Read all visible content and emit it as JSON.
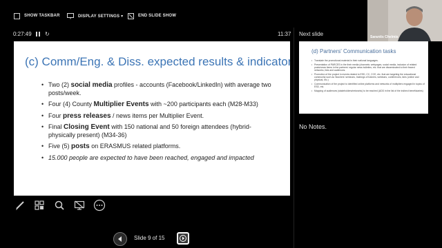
{
  "toolbar": {
    "show_taskbar": "SHOW TASKBAR",
    "display_settings": "DISPLAY SETTINGS ▾",
    "end_slide_show": "END SLIDE SHOW"
  },
  "timer": {
    "elapsed": "0:27:49",
    "clock": "11:37"
  },
  "current_slide": {
    "title": "(c) Comm/Eng. & Diss. expected results & indicators",
    "bullets": [
      {
        "pre": "Two (2) ",
        "bold": "social media",
        "post": " profiles - accounts (Facebook/LinkedIn) with average two posts/week."
      },
      {
        "pre": "Four (4) County ",
        "bold": "Multiplier Events",
        "post": " with ~200 participants each (M28-M33)"
      },
      {
        "pre": "Four ",
        "bold": "press releases",
        "post": " / news items per Multiplier Event."
      },
      {
        "pre": "Final ",
        "bold": "Closing Event",
        "post": " with 150 national and 50 foreign attendees (hybrid-physically present) (M34-36)"
      },
      {
        "pre": "Five (5) ",
        "bold": "posts",
        "post": " on ERASMUS related platforms."
      }
    ],
    "italic_bullet": "15.000 people are expected to have been reached, engaged and impacted"
  },
  "next_slide": {
    "label": "Next slide",
    "title": "(d) Partners' Communication tasks",
    "bullets": [
      "Translate the promotional material in their national languages.",
      "Presentation of PARCES in the their media (channels: webpages, social media, inclusion of related posts/news items in the partners' regular news bulletins, etc. that are disseminated to their feared networks, lists and audiences.",
      "Promotion of the project in events related to ESD, CC, CCE, etc. that are targeting the educational community such as 'teachers' seminars, trainings of trainers, webinars, conferences, fairs (online and physical, etc.)",
      "Communication of the project to identified online platforms and networks of multipliers engaged in topics of ESD, etc.",
      "Mapping of audiences (stakeholders/networks) to be reached (ADD in the list of the indirect beneficiaries)"
    ]
  },
  "notes": {
    "text": "No Notes."
  },
  "webcam": {
    "name": "Sarantis Chelmis"
  },
  "navigation": {
    "slide_counter": "Slide 9 of 15"
  },
  "tools": [
    "pen-tool-icon",
    "see-all-slides-icon",
    "zoom-icon",
    "camera-toggle-icon",
    "more-options-icon"
  ],
  "colors": {
    "title_blue": "#3b74b5",
    "background": "#000000"
  }
}
